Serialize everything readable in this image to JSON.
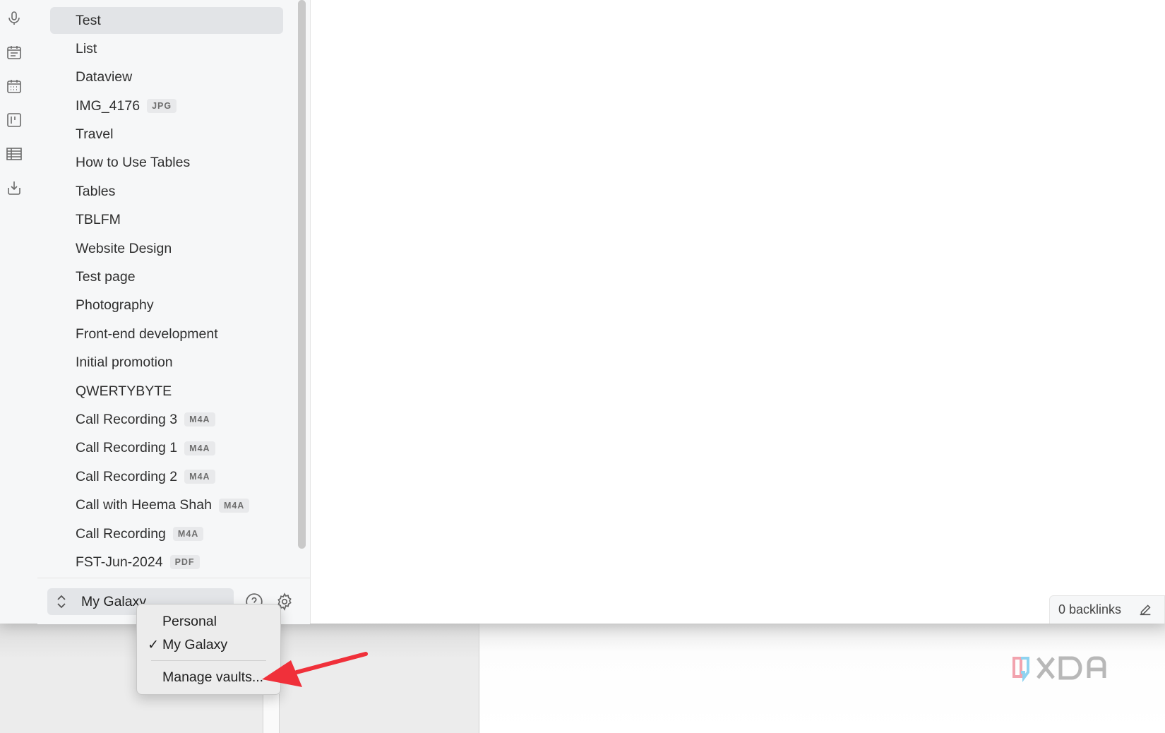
{
  "ribbon": {
    "icons": [
      "microphone-icon",
      "daily-note-calendar-icon",
      "calendar-icon",
      "kanban-board-icon",
      "table-icon",
      "import-icon"
    ]
  },
  "files": [
    {
      "name": "Test",
      "ext": "",
      "active": true
    },
    {
      "name": "List",
      "ext": ""
    },
    {
      "name": "Dataview",
      "ext": ""
    },
    {
      "name": "IMG_4176",
      "ext": "JPG"
    },
    {
      "name": "Travel",
      "ext": ""
    },
    {
      "name": "How to Use Tables",
      "ext": ""
    },
    {
      "name": "Tables",
      "ext": ""
    },
    {
      "name": "TBLFM",
      "ext": ""
    },
    {
      "name": "Website Design",
      "ext": ""
    },
    {
      "name": "Test page",
      "ext": ""
    },
    {
      "name": "Photography",
      "ext": ""
    },
    {
      "name": "Front-end development",
      "ext": ""
    },
    {
      "name": "Initial promotion",
      "ext": ""
    },
    {
      "name": "QWERTYBYTE",
      "ext": ""
    },
    {
      "name": "Call Recording 3",
      "ext": "M4A"
    },
    {
      "name": "Call Recording 1",
      "ext": "M4A"
    },
    {
      "name": "Call Recording 2",
      "ext": "M4A"
    },
    {
      "name": "Call with Heema Shah",
      "ext": "M4A"
    },
    {
      "name": "Call Recording",
      "ext": "M4A"
    },
    {
      "name": "FST-Jun-2024",
      "ext": "PDF"
    }
  ],
  "footer": {
    "vault_name": "My Galaxy",
    "help_icon": "help-circle-icon",
    "settings_icon": "gear-icon"
  },
  "status": {
    "backlinks": "0 backlinks"
  },
  "vault_menu": {
    "items": [
      "Personal",
      "My Galaxy"
    ],
    "checked": "My Galaxy",
    "manage": "Manage vaults..."
  },
  "watermark": {
    "brand": "XDA"
  },
  "colors": {
    "annotation_arrow": "#f0303a",
    "sidebar_bg": "#f6f7f8",
    "active_item_bg": "#e2e4e7"
  }
}
